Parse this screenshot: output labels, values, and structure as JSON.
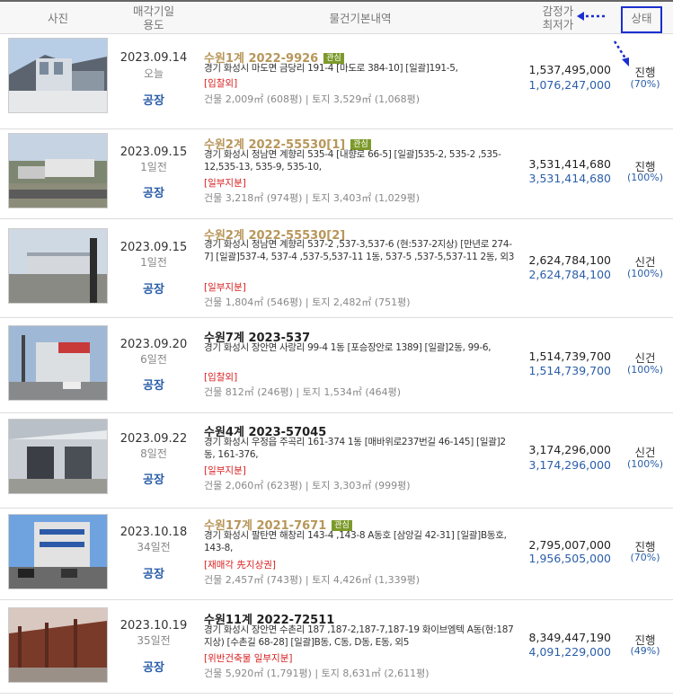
{
  "header": {
    "photo": "사진",
    "sale_date_l1": "매각기일",
    "sale_date_l2": "용도",
    "basic_info": "물건기본내역",
    "price_l1": "감정가",
    "price_l2": "최저가",
    "status": "상태"
  },
  "rows": [
    {
      "date": "2023.09.14",
      "ago": "오늘",
      "use": "공장",
      "case": "수원1계 2022-9926",
      "tag": "관심",
      "case_color": "gold",
      "addr": "경기 화성시 마도면 금당리 191-4 [마도로 384-10] [일괄]191-5,",
      "note": "[입찰외]",
      "area": "건물 2,009㎡ (608평)  |  토지 3,529㎡ (1,068평)",
      "appraisal": "1,537,495,000",
      "minimum": "1,076,247,000",
      "status": "진행",
      "pct": "(70%)"
    },
    {
      "date": "2023.09.15",
      "ago": "1일전",
      "use": "공장",
      "case": "수원2계 2022-55530[1]",
      "tag": "관심",
      "case_color": "gold",
      "addr": "경기 화성시 정남면 계향리 535-4 [내향로 66-5] [일괄]535-2, 535-2 ,535-12,535-13, 535-9, 535-10,",
      "note": "[일부지분]",
      "area": "건물 3,218㎡ (974평)  |  토지 3,403㎡ (1,029평)",
      "appraisal": "3,531,414,680",
      "minimum": "3,531,414,680",
      "status": "진행",
      "pct": "(100%)"
    },
    {
      "date": "2023.09.15",
      "ago": "1일전",
      "use": "공장",
      "case": "수원2계 2022-55530[2]",
      "tag": "",
      "case_color": "gold",
      "addr": "경기 화성시 정남면 계향리 537-2 ,537-3,537-6 (현:537-2지상) [만년로 274-7] [일괄]537-4, 537-4 ,537-5,537-11 1동, 537-5 ,537-5,537-11 2동, 외3",
      "note": "[일부지분]",
      "area": "건물 1,804㎡ (546평)  |  토지 2,482㎡ (751평)",
      "appraisal": "2,624,784,100",
      "minimum": "2,624,784,100",
      "status": "신건",
      "pct": "(100%)"
    },
    {
      "date": "2023.09.20",
      "ago": "6일전",
      "use": "공장",
      "case": "수원7계 2023-537",
      "tag": "",
      "case_color": "black",
      "addr": "경기 화성시 장안면 사랑리 99-4 1동 [포승장안로 1389] [일괄]2동, 99-6,",
      "note": "[입찰외]",
      "area": "건물 812㎡ (246평)  |  토지 1,534㎡ (464평)",
      "appraisal": "1,514,739,700",
      "minimum": "1,514,739,700",
      "status": "신건",
      "pct": "(100%)"
    },
    {
      "date": "2023.09.22",
      "ago": "8일전",
      "use": "공장",
      "case": "수원4계 2023-57045",
      "tag": "",
      "case_color": "black",
      "addr": "경기 화성시 우정읍 주곡리 161-374 1동 [매바위로237번길 46-145] [일괄]2동, 161-376,",
      "note": "[일부지분]",
      "area": "건물 2,060㎡ (623평)  |  토지 3,303㎡ (999평)",
      "appraisal": "3,174,296,000",
      "minimum": "3,174,296,000",
      "status": "신건",
      "pct": "(100%)"
    },
    {
      "date": "2023.10.18",
      "ago": "34일전",
      "use": "공장",
      "case": "수원17계 2021-7671",
      "tag": "관심",
      "case_color": "gold",
      "addr": "경기 화성시 팔탄면 해창리 143-4 ,143-8 A동호 [삼앙길 42-31] [일괄]B동호, 143-8,",
      "note": "[재매각   先지상권]",
      "area": "건물 2,457㎡ (743평)  |  토지 4,426㎡ (1,339평)",
      "appraisal": "2,795,007,000",
      "minimum": "1,956,505,000",
      "status": "진행",
      "pct": "(70%)"
    },
    {
      "date": "2023.10.19",
      "ago": "35일전",
      "use": "공장",
      "case": "수원11계 2022-72511",
      "tag": "",
      "case_color": "black",
      "addr": "경기 화성시 장안면 수촌리 187 ,187-2,187-7,187-19 화이브엠텍 A동(현:187지상) [수촌길 68-28] [일괄]B동, C동, D동, E동, 외5",
      "note": "[위반건축물   일부지분]",
      "area": "건물 5,920㎡ (1,791평)  |  토지 8,631㎡ (2,611평)",
      "appraisal": "8,349,447,190",
      "minimum": "4,091,229,000",
      "status": "진행",
      "pct": "(49%)"
    }
  ]
}
